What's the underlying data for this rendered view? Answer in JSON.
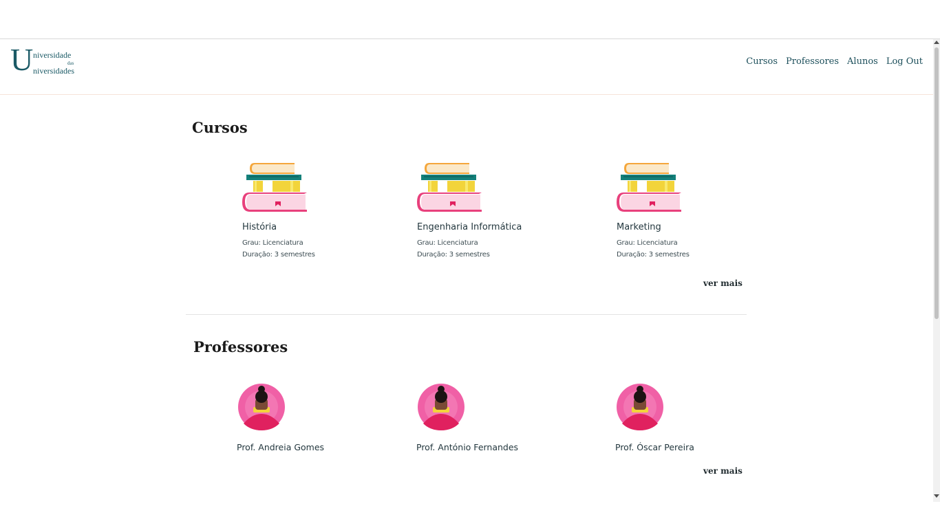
{
  "logo": {
    "big_letter": "U",
    "line1": "niversidade",
    "line2": "das",
    "line3": "niversidades"
  },
  "nav": {
    "items": [
      "Cursos",
      "Professores",
      "Alunos",
      "Log Out"
    ]
  },
  "courses": {
    "title": "Cursos",
    "items": [
      {
        "name": "História",
        "degree": "Grau: Licenciatura",
        "duration": "Duração: 3 semestres"
      },
      {
        "name": "Engenharia Informática",
        "degree": "Grau: Licenciatura",
        "duration": "Duração: 3 semestres"
      },
      {
        "name": "Marketing",
        "degree": "Grau: Licenciatura",
        "duration": "Duração: 3 semestres"
      }
    ],
    "more_label": "ver mais"
  },
  "professors": {
    "title": "Professores",
    "items": [
      {
        "name": "Prof. Andreia Gomes"
      },
      {
        "name": "Prof. António Fernandes"
      },
      {
        "name": "Prof. Óscar Pereira"
      }
    ],
    "more_label": "ver mais"
  },
  "colors": {
    "brand": "#1b5a66",
    "accent_pink": "#e8407c",
    "book_teal": "#13807a",
    "book_yellow": "#f2d43b"
  }
}
